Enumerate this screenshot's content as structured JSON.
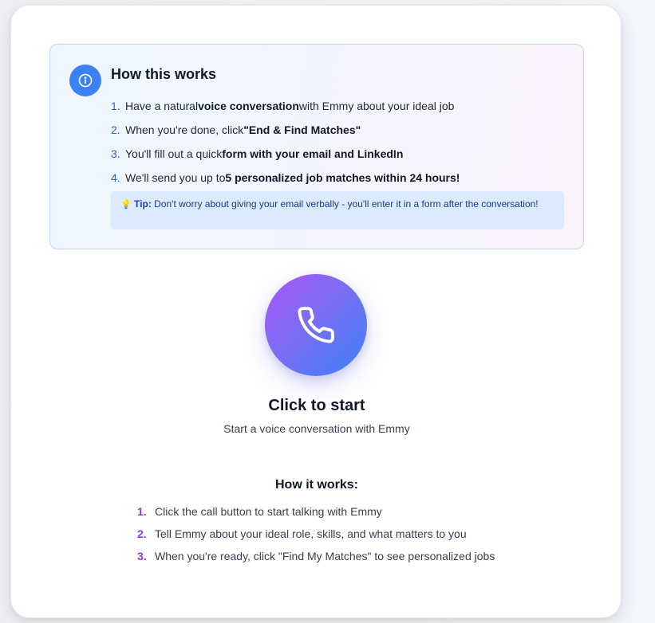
{
  "info": {
    "title": "How this works",
    "icon": "info-icon",
    "steps": [
      {
        "num": "1.",
        "pre": "Have a natural ",
        "bold": "voice conversation",
        "post": " with Emmy about your ideal job"
      },
      {
        "num": "2.",
        "pre": "When you're done, click ",
        "bold": "\"End & Find Matches\"",
        "post": ""
      },
      {
        "num": "3.",
        "pre": "You'll fill out a quick ",
        "bold": "form with your email and LinkedIn",
        "post": ""
      },
      {
        "num": "4.",
        "pre": "We'll send you up to ",
        "bold": "5 personalized job matches within 24 hours!",
        "post": ""
      }
    ],
    "tip": {
      "emoji": "💡",
      "label": "Tip:",
      "text": " Don't worry about giving your email verbally - you'll enter it in a form after the conversation!"
    }
  },
  "call": {
    "icon": "phone-icon",
    "title": "Click to start",
    "subtitle": "Start a voice conversation with Emmy"
  },
  "how": {
    "title": "How it works:",
    "steps": [
      {
        "num": "1.",
        "text": "Click the call button to start talking with Emmy"
      },
      {
        "num": "2.",
        "text": "Tell Emmy about your ideal role, skills, and what matters to you"
      },
      {
        "num": "3.",
        "text": "When you're ready, click \"Find My Matches\" to see personalized jobs"
      }
    ]
  },
  "colors": {
    "accent_blue": "#3b82f6",
    "accent_purple": "#9333ea",
    "tip_bg": "#dbeafe"
  }
}
